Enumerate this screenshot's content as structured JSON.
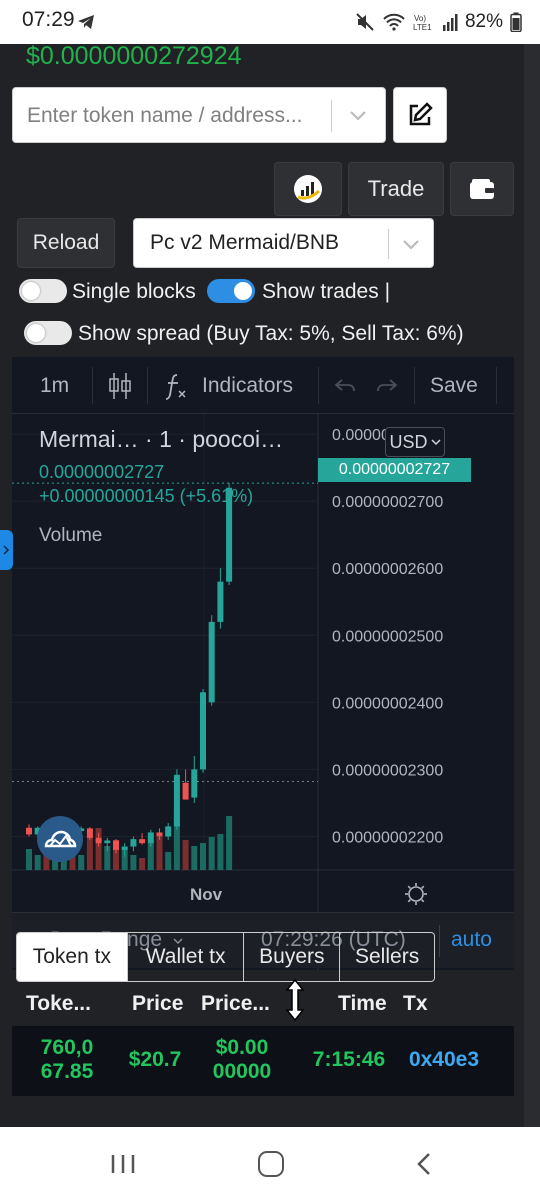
{
  "status_bar": {
    "time": "07:29",
    "battery": "82%"
  },
  "token_price": "$0.0000000272924",
  "search": {
    "placeholder": "Enter token name / address..."
  },
  "buttons": {
    "trade": "Trade",
    "reload": "Reload"
  },
  "pair_select": {
    "value": "Pc v2 Mermaid/BNB"
  },
  "toggles": {
    "single_blocks": {
      "label": "Single blocks",
      "on": false
    },
    "show_trades": {
      "label": "Show trades |",
      "on": true
    },
    "show_spread": {
      "label": "Show spread (Buy Tax: 5%, Sell Tax: 6%)",
      "on": false
    }
  },
  "chart_toolbar": {
    "interval": "1m",
    "indicators": "Indicators",
    "save": "Save"
  },
  "chart_legend": {
    "name": "Mermai… · 1 · poocoi…",
    "price": "0.00000002727",
    "change": "+0.00000000145 (+5.61%)",
    "volume": "Volume",
    "currency": "USD"
  },
  "chart_data": {
    "type": "candlestick",
    "title": "Mermai… · 1 · poocoi…",
    "currency": "USD",
    "interval": "1m",
    "y_ticks": [
      "0.00000002800",
      "0.00000002700",
      "0.00000002600",
      "0.00000002500",
      "0.00000002400",
      "0.00000002300",
      "0.00000002200"
    ],
    "y_tick_values": [
      2.8e-08,
      2.7e-08,
      2.6e-08,
      2.5e-08,
      2.4e-08,
      2.3e-08,
      2.2e-08
    ],
    "ylim": [
      2.15e-08,
      2.83e-08
    ],
    "x_ticks": [
      "Nov"
    ],
    "current_price_label": "0.00000002727",
    "current_price": 2.727e-08,
    "reference_line": 2.282e-08,
    "grid": true,
    "candles": [
      {
        "o": 2.213e-08,
        "h": 2.218e-08,
        "l": 2.2e-08,
        "c": 2.203e-08
      },
      {
        "o": 2.203e-08,
        "h": 2.215e-08,
        "l": 2.2e-08,
        "c": 2.213e-08
      },
      {
        "o": 2.213e-08,
        "h": 2.218e-08,
        "l": 2.205e-08,
        "c": 2.208e-08
      },
      {
        "o": 2.208e-08,
        "h": 2.214e-08,
        "l": 2.202e-08,
        "c": 2.212e-08
      },
      {
        "o": 2.212e-08,
        "h": 2.22e-08,
        "l": 2.205e-08,
        "c": 2.215e-08
      },
      {
        "o": 2.215e-08,
        "h": 2.218e-08,
        "l": 2.206e-08,
        "c": 2.208e-08
      },
      {
        "o": 2.208e-08,
        "h": 2.215e-08,
        "l": 2.2e-08,
        "c": 2.212e-08
      },
      {
        "o": 2.212e-08,
        "h": 2.214e-08,
        "l": 2.195e-08,
        "c": 2.198e-08
      },
      {
        "o": 2.198e-08,
        "h": 2.205e-08,
        "l": 2.185e-08,
        "c": 2.19e-08
      },
      {
        "o": 2.19e-08,
        "h": 2.198e-08,
        "l": 2.178e-08,
        "c": 2.194e-08
      },
      {
        "o": 2.194e-08,
        "h": 2.196e-08,
        "l": 2.175e-08,
        "c": 2.18e-08
      },
      {
        "o": 2.18e-08,
        "h": 2.19e-08,
        "l": 2.17e-08,
        "c": 2.185e-08
      },
      {
        "o": 2.185e-08,
        "h": 2.2e-08,
        "l": 2.178e-08,
        "c": 2.196e-08
      },
      {
        "o": 2.196e-08,
        "h": 2.205e-08,
        "l": 2.188e-08,
        "c": 2.19e-08
      },
      {
        "o": 2.19e-08,
        "h": 2.21e-08,
        "l": 2.185e-08,
        "c": 2.206e-08
      },
      {
        "o": 2.206e-08,
        "h": 2.212e-08,
        "l": 2.195e-08,
        "c": 2.2e-08
      },
      {
        "o": 2.2e-08,
        "h": 2.22e-08,
        "l": 2.195e-08,
        "c": 2.215e-08
      },
      {
        "o": 2.215e-08,
        "h": 2.3e-08,
        "l": 2.21e-08,
        "c": 2.292e-08
      },
      {
        "o": 2.28e-08,
        "h": 2.3e-08,
        "l": 2.26e-08,
        "c": 2.255e-08
      },
      {
        "o": 2.258e-08,
        "h": 2.32e-08,
        "l": 2.25e-08,
        "c": 2.3e-08
      },
      {
        "o": 2.3e-08,
        "h": 2.42e-08,
        "l": 2.295e-08,
        "c": 2.415e-08
      },
      {
        "o": 2.4e-08,
        "h": 2.53e-08,
        "l": 2.395e-08,
        "c": 2.52e-08
      },
      {
        "o": 2.52e-08,
        "h": 2.6e-08,
        "l": 2.51e-08,
        "c": 2.58e-08
      },
      {
        "o": 2.58e-08,
        "h": 2.727e-08,
        "l": 2.575e-08,
        "c": 2.72e-08
      }
    ],
    "volumes": [
      0.35,
      0.25,
      0.3,
      0.45,
      0.2,
      0.3,
      0.25,
      0.55,
      0.7,
      0.4,
      0.5,
      0.35,
      0.25,
      0.2,
      0.45,
      0.55,
      0.3,
      0.95,
      0.5,
      0.4,
      0.45,
      0.55,
      0.6,
      0.9
    ],
    "volume_up": [
      true,
      true,
      false,
      true,
      true,
      false,
      true,
      false,
      false,
      true,
      false,
      true,
      true,
      false,
      true,
      false,
      true,
      true,
      false,
      true,
      true,
      true,
      true,
      true
    ]
  },
  "date_bar": {
    "date_range": "Date Range",
    "clock": "07:29:26 (UTC)",
    "auto": "auto"
  },
  "tabs": [
    {
      "label": "Token tx",
      "active": true
    },
    {
      "label": "Wallet tx",
      "active": false
    },
    {
      "label": "Buyers",
      "active": false
    },
    {
      "label": "Sellers",
      "active": false
    }
  ],
  "tx_table": {
    "headers": [
      "Toke...",
      "Price",
      "Price...",
      "Time",
      "Tx"
    ],
    "rows": [
      {
        "tokens": "760,0\n67.85",
        "price": "$20.7",
        "price_per": "$0.00\n00000",
        "time": "7:15:46",
        "tx": "0x40e3"
      }
    ]
  },
  "colors": {
    "up": "#26a69a",
    "down": "#ef5350",
    "accent": "#2d8ee3",
    "green_text": "#22b14c"
  }
}
